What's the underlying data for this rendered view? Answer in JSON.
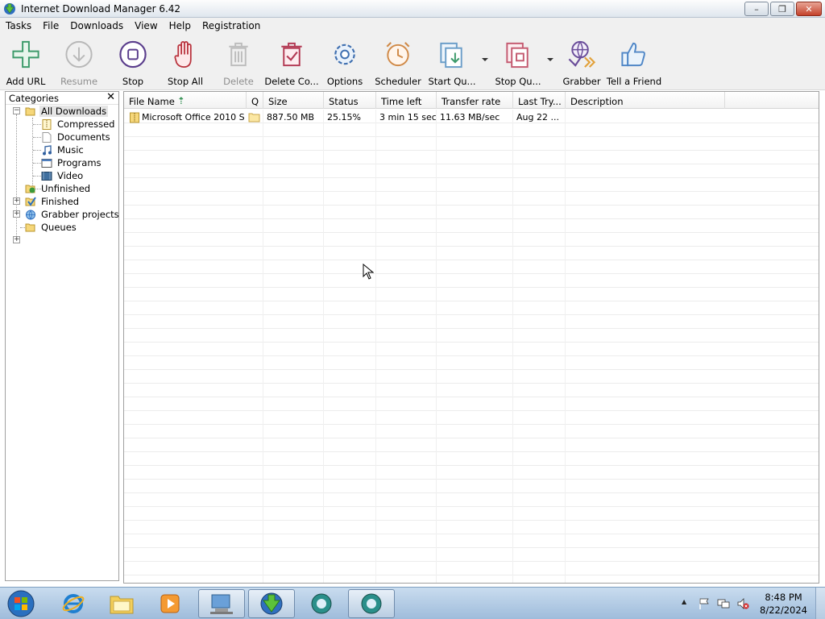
{
  "window": {
    "title": "Internet Download Manager 6.42",
    "controls": {
      "minimize": "–",
      "maximize": "❐",
      "close": "✕"
    }
  },
  "menu": [
    "Tasks",
    "File",
    "Downloads",
    "View",
    "Help",
    "Registration"
  ],
  "toolbar": {
    "add_url": "Add URL",
    "resume": "Resume",
    "stop": "Stop",
    "stop_all": "Stop All",
    "delete": "Delete",
    "delete_completed": "Delete Co...",
    "options": "Options",
    "scheduler": "Scheduler",
    "start_queue": "Start Qu...",
    "stop_queue": "Stop Qu...",
    "grabber": "Grabber",
    "tell_friend": "Tell a Friend"
  },
  "categories": {
    "title": "Categories",
    "close": "✕",
    "all_downloads": "All Downloads",
    "compressed": "Compressed",
    "documents": "Documents",
    "music": "Music",
    "programs": "Programs",
    "video": "Video",
    "unfinished": "Unfinished",
    "finished": "Finished",
    "grabber_projects": "Grabber projects",
    "queues": "Queues",
    "expander_minus": "−",
    "expander_plus": "+"
  },
  "list": {
    "columns": {
      "file_name": "File Name",
      "q": "Q",
      "size": "Size",
      "status": "Status",
      "time_left": "Time left",
      "transfer_rate": "Transfer rate",
      "last_try": "Last Try...",
      "description": "Description"
    },
    "rows": [
      {
        "file_name": "Microsoft Office 2010 S...",
        "size": "887.50  MB",
        "status": "25.15%",
        "time_left": "3 min 15 sec",
        "transfer_rate": "11.63  MB/sec",
        "last_try": "Aug 22 ...",
        "description": ""
      }
    ]
  },
  "taskbar": {
    "time": "8:48 PM",
    "date": "8/22/2024",
    "tray_arrow": "▲"
  },
  "colors": {
    "accent": "#3a8f3a",
    "titlebar": "#dfe6ee",
    "taskbar": "#b3cbe4"
  }
}
